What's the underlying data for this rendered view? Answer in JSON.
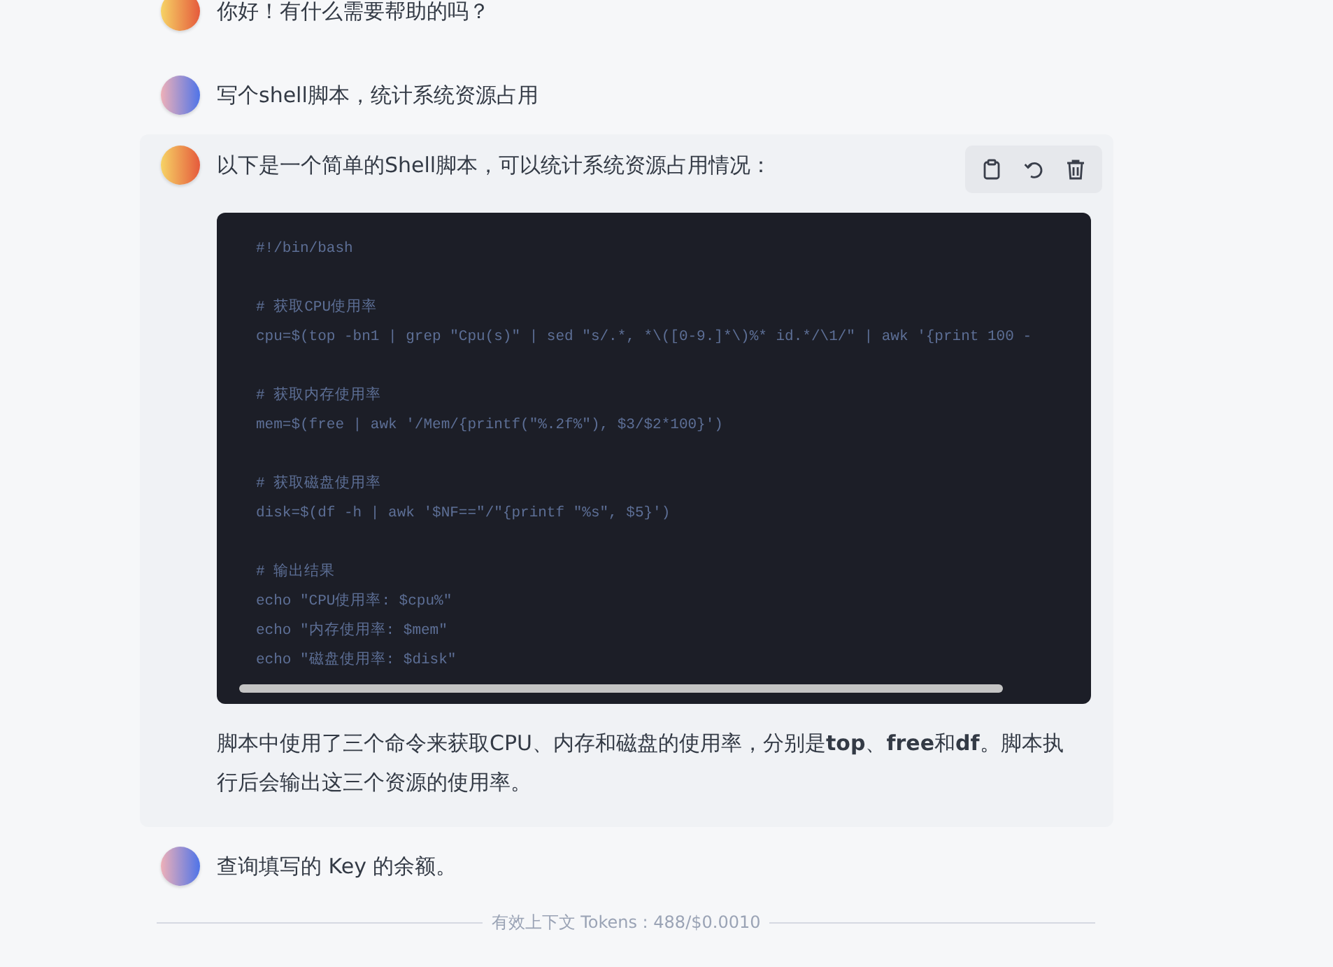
{
  "messages": [
    {
      "kind": "assistant",
      "text": "你好！有什么需要帮助的吗？"
    },
    {
      "kind": "user",
      "text": "写个shell脚本，统计系统资源占用"
    },
    {
      "kind": "assistant",
      "highlighted": true,
      "text": "以下是一个简单的Shell脚本，可以统计系统资源占用情况：",
      "actions": [
        {
          "kind": "copy"
        },
        {
          "kind": "retry"
        },
        {
          "kind": "delete"
        }
      ],
      "code": {
        "blocks": [
          [
            "#!/bin/bash"
          ],
          [
            "# 获取CPU使用率",
            "cpu=$(top -bn1 | grep \"Cpu(s)\" | sed \"s/.*, *\\([0-9.]*\\)%* id.*/\\1/\" | awk '{print 100 -"
          ],
          [
            "# 获取内存使用率",
            "mem=$(free | awk '/Mem/{printf(\"%.2f%\"), $3/$2*100}')"
          ],
          [
            "# 获取磁盘使用率",
            "disk=$(df -h | awk '$NF==\"/\"{printf \"%s\", $5}')"
          ],
          [
            "# 输出结果",
            "echo \"CPU使用率: $cpu%\"",
            "echo \"内存使用率: $mem\"",
            "echo \"磁盘使用率: $disk\""
          ]
        ]
      },
      "after": "脚本中使用了三个命令来获取CPU、内存和磁盘的使用率，分别是**top**、**free**和**df**。脚本执行后会输出这三个资源的使用率。"
    },
    {
      "kind": "user",
      "text": "查询填写的 Key 的余额。"
    }
  ],
  "footer": "有效上下文 Tokens : 488/$0.0010"
}
